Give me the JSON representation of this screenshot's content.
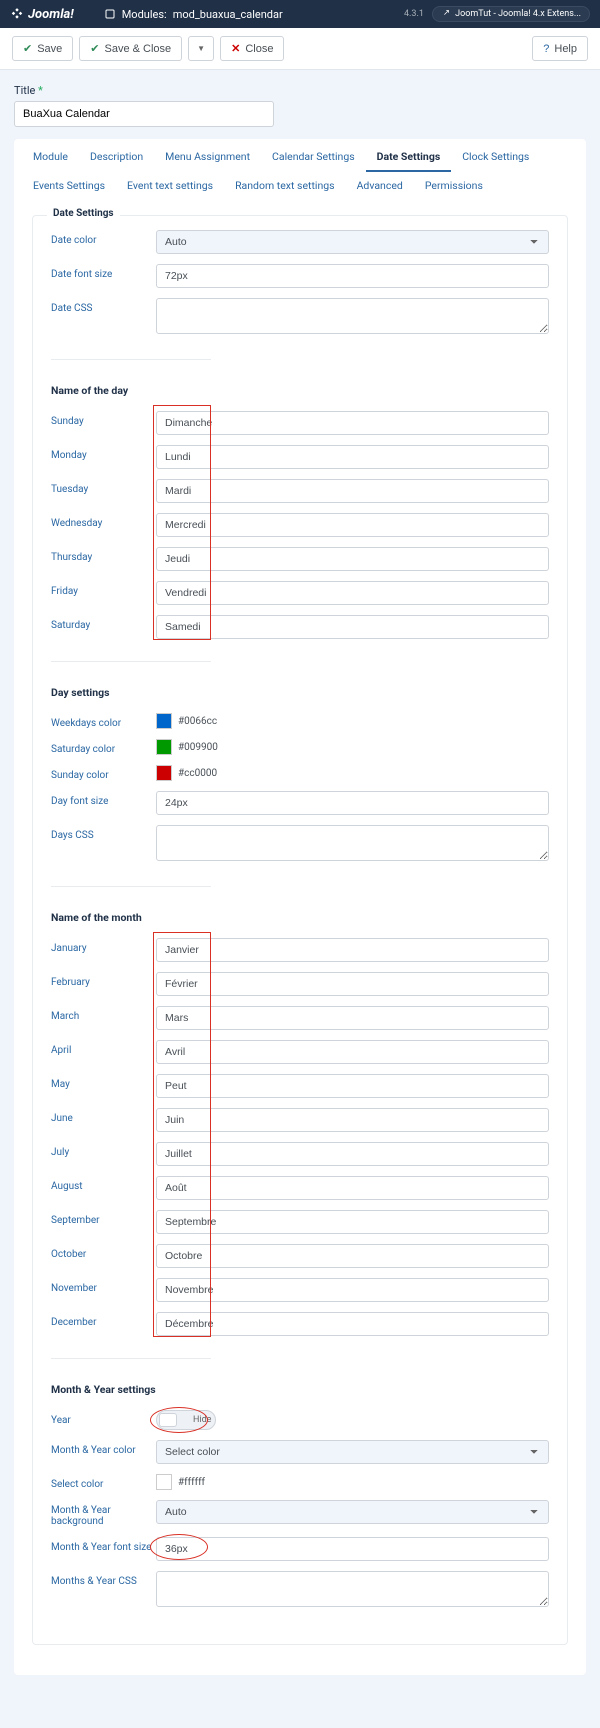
{
  "topbar": {
    "brand": "Joomla!",
    "module_prefix": "Modules:",
    "module_name": "mod_buaxua_calendar",
    "version": "4.3.1",
    "badge": "JoomTut - Joomla! 4.x Extens..."
  },
  "toolbar": {
    "save": "Save",
    "save_close": "Save & Close",
    "close": "Close",
    "help": "Help"
  },
  "title": {
    "label": "Title",
    "value": "BuaXua Calendar"
  },
  "tabs": [
    "Module",
    "Description",
    "Menu Assignment",
    "Calendar Settings",
    "Date Settings",
    "Clock Settings",
    "Events Settings",
    "Event text settings",
    "Random text settings",
    "Advanced",
    "Permissions"
  ],
  "active_tab": 4,
  "date_settings": {
    "legend": "Date Settings",
    "date_color_label": "Date color",
    "date_color_value": "Auto",
    "date_font_size_label": "Date font size",
    "date_font_size_value": "72px",
    "date_css_label": "Date CSS",
    "date_css_value": ""
  },
  "name_of_day": {
    "heading": "Name of the day",
    "days": [
      {
        "label": "Sunday",
        "value": "Dimanche"
      },
      {
        "label": "Monday",
        "value": "Lundi"
      },
      {
        "label": "Tuesday",
        "value": "Mardi"
      },
      {
        "label": "Wednesday",
        "value": "Mercredi"
      },
      {
        "label": "Thursday",
        "value": "Jeudi"
      },
      {
        "label": "Friday",
        "value": "Vendredi"
      },
      {
        "label": "Saturday",
        "value": "Samedi"
      }
    ]
  },
  "day_settings": {
    "heading": "Day settings",
    "weekdays_color_label": "Weekdays color",
    "weekdays_color": "#0066cc",
    "saturday_color_label": "Saturday color",
    "saturday_color": "#009900",
    "sunday_color_label": "Sunday color",
    "sunday_color": "#cc0000",
    "day_font_size_label": "Day font size",
    "day_font_size": "24px",
    "days_css_label": "Days CSS",
    "days_css": ""
  },
  "name_of_month": {
    "heading": "Name of the month",
    "months": [
      {
        "label": "January",
        "value": "Janvier"
      },
      {
        "label": "February",
        "value": "Février"
      },
      {
        "label": "March",
        "value": "Mars"
      },
      {
        "label": "April",
        "value": "Avril"
      },
      {
        "label": "May",
        "value": "Peut"
      },
      {
        "label": "June",
        "value": "Juin"
      },
      {
        "label": "July",
        "value": "Juillet"
      },
      {
        "label": "August",
        "value": "Août"
      },
      {
        "label": "September",
        "value": "Septembre"
      },
      {
        "label": "October",
        "value": "Octobre"
      },
      {
        "label": "November",
        "value": "Novembre"
      },
      {
        "label": "December",
        "value": "Décembre"
      }
    ]
  },
  "month_year": {
    "heading": "Month & Year settings",
    "year_label": "Year",
    "year_toggle": "Hide",
    "my_color_label": "Month & Year color",
    "my_color_value": "Select color",
    "select_color_label": "Select color",
    "select_color_value": "#ffffff",
    "my_bg_label": "Month & Year background",
    "my_bg_value": "Auto",
    "my_font_size_label": "Month & Year font size",
    "my_font_size": "36px",
    "my_css_label": "Months & Year CSS",
    "my_css": ""
  }
}
